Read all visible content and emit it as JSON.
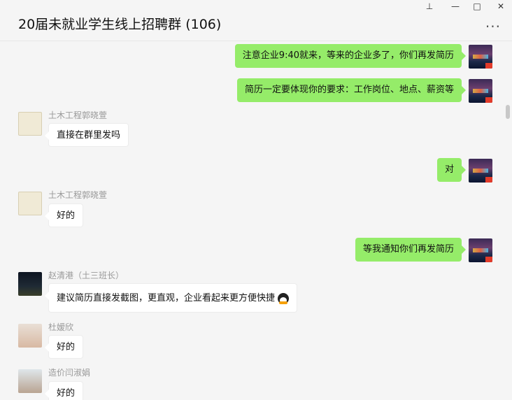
{
  "window": {
    "title": "20届未就业学生线上招聘群 (106)",
    "pin_label": "⊥",
    "minimize_label": "—",
    "maximize_label": "□",
    "close_label": "✕",
    "more_label": "···"
  },
  "messages": [
    {
      "side": "me",
      "text": "注意企业9:40就来，等来的企业多了，你们再发简历"
    },
    {
      "side": "me",
      "text": "简历一定要体现你的要求：工作岗位、地点、薪资等"
    },
    {
      "side": "other",
      "sender": "土木工程郭晓萱",
      "text": "直接在群里发吗"
    },
    {
      "side": "me",
      "text": "对"
    },
    {
      "side": "other",
      "sender": "土木工程郭晓萱",
      "text": "好的"
    },
    {
      "side": "me",
      "text": "等我通知你们再发简历"
    },
    {
      "side": "other",
      "sender": "赵清港（土三班长）",
      "text": "建议简历直接发截图，更直观，企业看起来更方便快捷"
    },
    {
      "side": "other",
      "sender": "杜嫒欣",
      "text": "好的"
    },
    {
      "side": "other",
      "sender": "造价闫淑娟",
      "text": "好的"
    }
  ],
  "icons": {
    "emoji": "qq-penguin-icon"
  }
}
